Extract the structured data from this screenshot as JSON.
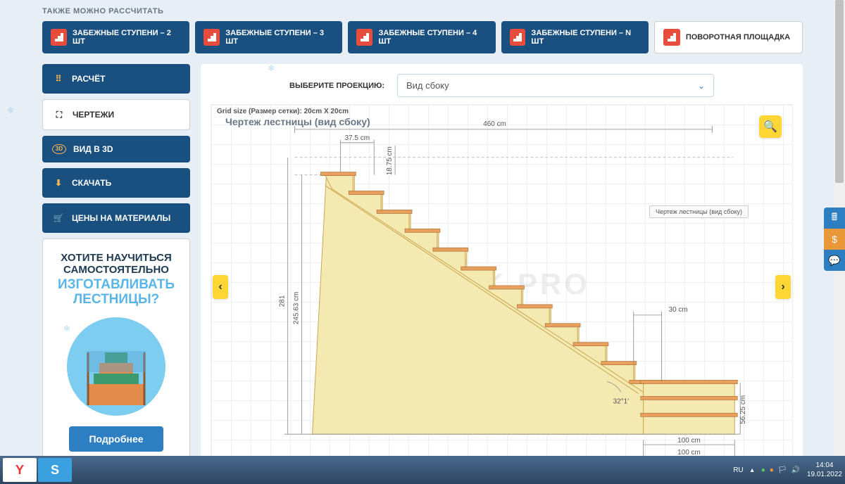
{
  "section_title": "ТАКЖЕ МОЖНО РАССЧИТАТЬ",
  "top_buttons": [
    {
      "label": "ЗАБЕЖНЫЕ СТУПЕНИ – 2 ШТ",
      "style": "blue"
    },
    {
      "label": "ЗАБЕЖНЫЕ СТУПЕНИ – 3 ШТ",
      "style": "blue"
    },
    {
      "label": "ЗАБЕЖНЫЕ СТУПЕНИ – 4 ШТ",
      "style": "blue"
    },
    {
      "label": "ЗАБЕЖНЫЕ СТУПЕНИ – N ШТ",
      "style": "blue"
    },
    {
      "label": "ПОВОРОТНАЯ ПЛОЩАДКА",
      "style": "white"
    }
  ],
  "sidebar": [
    {
      "label": "РАСЧЁТ",
      "icon": "grid",
      "style": "blue"
    },
    {
      "label": "ЧЕРТЕЖИ",
      "icon": "crop",
      "style": "white"
    },
    {
      "label": "ВИД В 3D",
      "icon": "3d",
      "style": "blue"
    },
    {
      "label": "СКАЧАТЬ",
      "icon": "download",
      "style": "blue"
    },
    {
      "label": "ЦЕНЫ НА МАТЕРИАЛЫ",
      "icon": "cart",
      "style": "blue"
    }
  ],
  "promo": {
    "line1": "ХОТИТЕ НАУЧИТЬСЯ",
    "line2": "САМОСТОЯТЕЛЬНО",
    "line3": "ИЗГОТАВЛИВАТЬ",
    "line4": "ЛЕСТНИЦЫ?",
    "button": "Подробнее"
  },
  "projection": {
    "label": "ВЫБЕРИТЕ ПРОЕКЦИЮ:",
    "value": "Вид сбоку"
  },
  "drawing": {
    "grid_info": "Grid size (Размер сетки): 20cm X 20cm",
    "title": "Чертеж лестницы (вид сбоку)",
    "badge": "Чертеж лестницы (вид сбоку)",
    "watermark": "KALK.PRO",
    "dims": {
      "width_total": "460 cm",
      "step_w": "37.5 cm",
      "step_h": "18.75 cm",
      "height_left_a": "281",
      "height_left_b": "245.63 cm",
      "step_depth": "30 cm",
      "angle": "32°1'",
      "platform_h": "56.25 cm",
      "platform_w1": "100 cm",
      "platform_w2": "100 cm"
    }
  },
  "taskbar": {
    "lang": "RU",
    "time": "14:04",
    "date": "19.01.2022"
  }
}
